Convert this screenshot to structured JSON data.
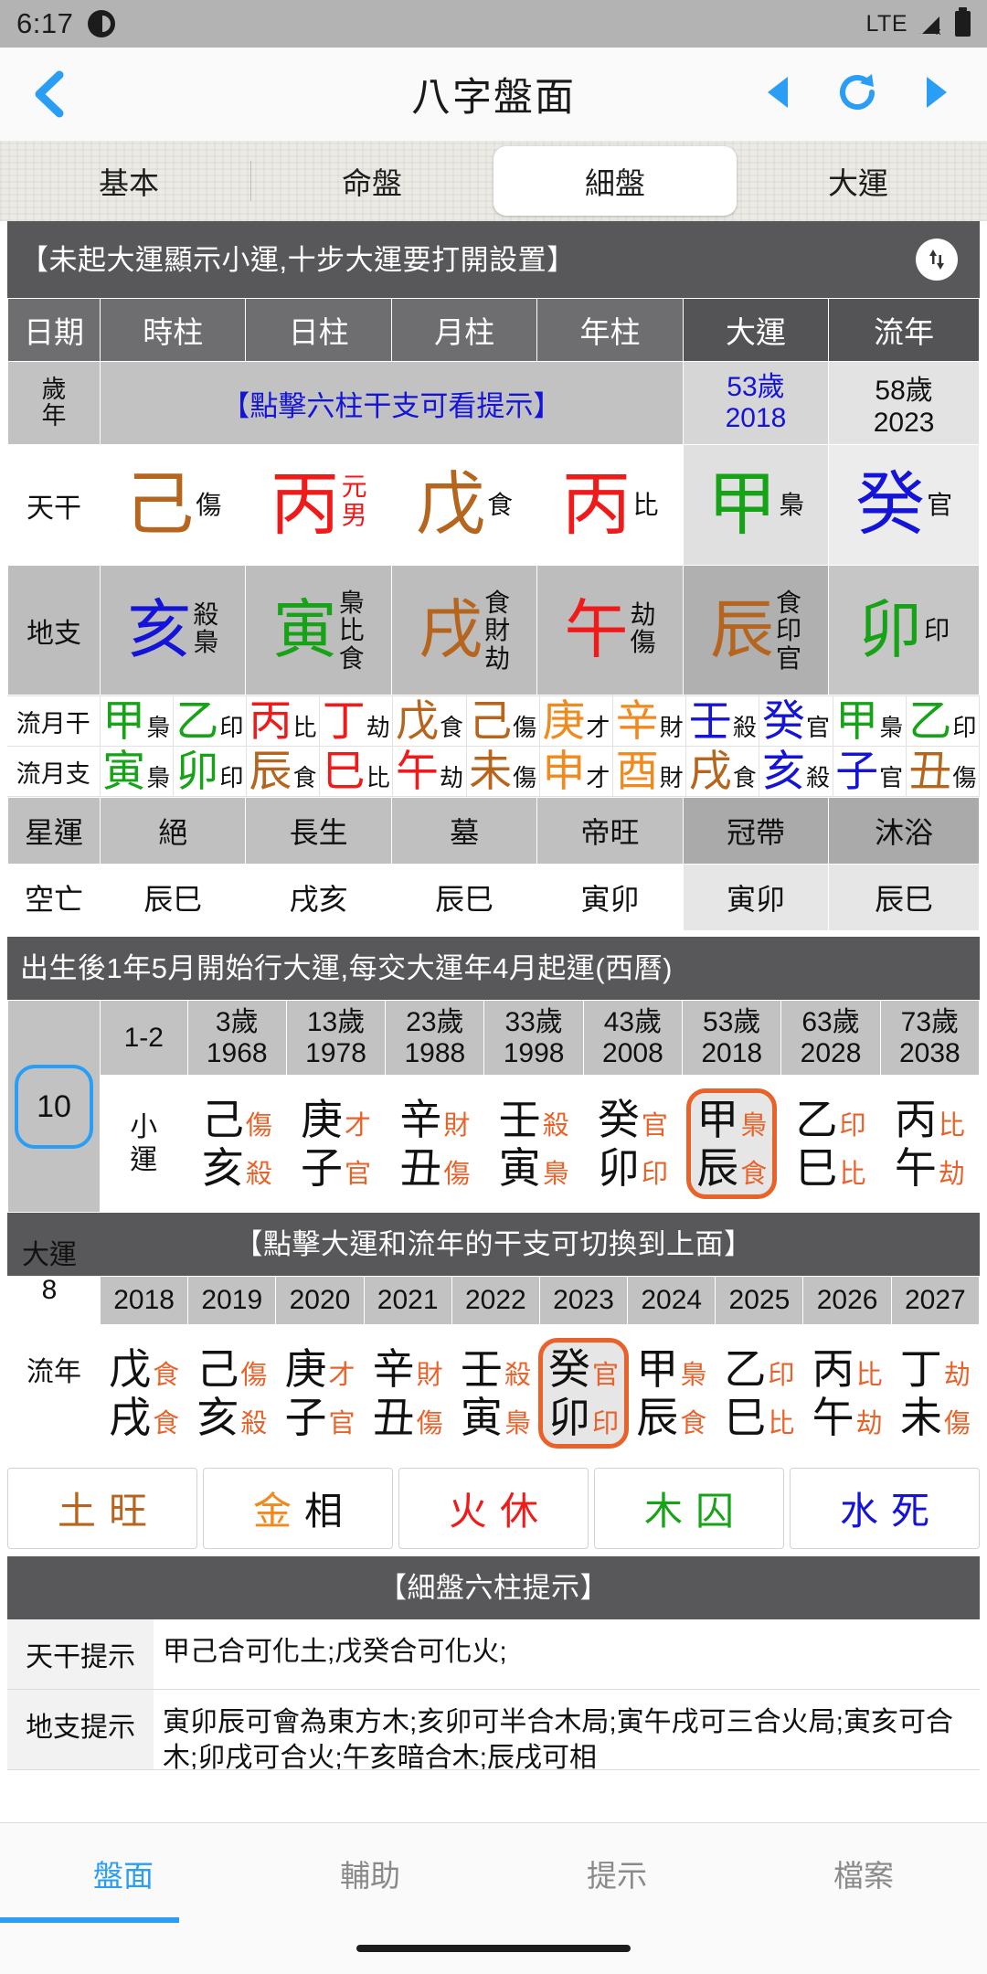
{
  "status_bar": {
    "time": "6:17",
    "network": "LTE",
    "app_icon": "app-circle-icon",
    "signal_icon": "signal-off-icon",
    "battery_icon": "battery-full-icon"
  },
  "title_bar": {
    "back_icon": "chevron-left-icon",
    "title": "八字盤面",
    "prev_icon": "triangle-left-icon",
    "refresh_icon": "refresh-icon",
    "next_icon": "triangle-right-icon",
    "accent": "#2a9df4"
  },
  "tabs": [
    {
      "label": "基本",
      "selected": false
    },
    {
      "label": "命盤",
      "selected": false
    },
    {
      "label": "細盤",
      "selected": true
    },
    {
      "label": "大運",
      "selected": false
    }
  ],
  "banner_top": {
    "text": "【未起大運顯示小運,十步大運要打開設置】",
    "swap_icon": "swap-vertical-icon"
  },
  "grid": {
    "headers": [
      "日期",
      "時柱",
      "日柱",
      "月柱",
      "年柱",
      "大運",
      "流年"
    ],
    "age_row": {
      "label_line1": "歲",
      "label_line2": "年",
      "note": "【點擊六柱干支可看提示】",
      "dayun_age": "53歲",
      "dayun_year": "2018",
      "liunian_age": "58歲",
      "liunian_year": "2023"
    },
    "stems": {
      "label": "天干",
      "cells": [
        {
          "char": "己",
          "color": "#b5651d",
          "ann": [
            "傷"
          ]
        },
        {
          "char": "丙",
          "color": "#ef1b1b",
          "ann": [
            "元",
            "男"
          ],
          "ann_color": "#ef1b1b"
        },
        {
          "char": "戊",
          "color": "#b5651d",
          "ann": [
            "食"
          ]
        },
        {
          "char": "丙",
          "color": "#ef1b1b",
          "ann": [
            "比"
          ]
        },
        {
          "char": "甲",
          "color": "#17a317",
          "ann": [
            "梟"
          ]
        },
        {
          "char": "癸",
          "color": "#1414d8",
          "ann": [
            "官"
          ]
        }
      ]
    },
    "branches": {
      "label": "地支",
      "cells": [
        {
          "char": "亥",
          "color": "#1414d8",
          "ann": [
            "殺",
            "梟"
          ]
        },
        {
          "char": "寅",
          "color": "#17a317",
          "ann": [
            "梟",
            "比",
            "食"
          ]
        },
        {
          "char": "戌",
          "color": "#b5651d",
          "ann": [
            "食",
            "財",
            "劫"
          ]
        },
        {
          "char": "午",
          "color": "#ef1b1b",
          "ann": [
            "劫",
            "傷"
          ]
        },
        {
          "char": "辰",
          "color": "#b5651d",
          "ann": [
            "食",
            "印",
            "官"
          ]
        },
        {
          "char": "卯",
          "color": "#17a317",
          "ann": [
            "印"
          ]
        }
      ]
    },
    "month_stems": {
      "label": "流月干",
      "cells": [
        {
          "char": "甲",
          "color": "#17a317",
          "ann": "梟"
        },
        {
          "char": "乙",
          "color": "#17a317",
          "ann": "印"
        },
        {
          "char": "丙",
          "color": "#ef1b1b",
          "ann": "比"
        },
        {
          "char": "丁",
          "color": "#ef1b1b",
          "ann": "劫"
        },
        {
          "char": "戊",
          "color": "#b5651d",
          "ann": "食"
        },
        {
          "char": "己",
          "color": "#b5651d",
          "ann": "傷"
        },
        {
          "char": "庚",
          "color": "#f08a1e",
          "ann": "才"
        },
        {
          "char": "辛",
          "color": "#f08a1e",
          "ann": "財"
        },
        {
          "char": "壬",
          "color": "#1414d8",
          "ann": "殺"
        },
        {
          "char": "癸",
          "color": "#1414d8",
          "ann": "官"
        },
        {
          "char": "甲",
          "color": "#17a317",
          "ann": "梟"
        },
        {
          "char": "乙",
          "color": "#17a317",
          "ann": "印"
        }
      ]
    },
    "month_branches": {
      "label": "流月支",
      "cells": [
        {
          "char": "寅",
          "color": "#17a317",
          "ann": "梟"
        },
        {
          "char": "卯",
          "color": "#17a317",
          "ann": "印"
        },
        {
          "char": "辰",
          "color": "#b5651d",
          "ann": "食"
        },
        {
          "char": "巳",
          "color": "#ef1b1b",
          "ann": "比"
        },
        {
          "char": "午",
          "color": "#ef1b1b",
          "ann": "劫"
        },
        {
          "char": "未",
          "color": "#b5651d",
          "ann": "傷"
        },
        {
          "char": "申",
          "color": "#f08a1e",
          "ann": "才"
        },
        {
          "char": "酉",
          "color": "#f08a1e",
          "ann": "財"
        },
        {
          "char": "戌",
          "color": "#b5651d",
          "ann": "食"
        },
        {
          "char": "亥",
          "color": "#1414d8",
          "ann": "殺"
        },
        {
          "char": "子",
          "color": "#1414d8",
          "ann": "官"
        },
        {
          "char": "丑",
          "color": "#b5651d",
          "ann": "傷"
        }
      ]
    },
    "star_luck": {
      "label": "星運",
      "values": [
        "絕",
        "長生",
        "墓",
        "帝旺",
        "冠帶",
        "沐浴"
      ]
    },
    "void": {
      "label": "空亡",
      "values": [
        "辰巳",
        "戌亥",
        "辰巳",
        "寅卯",
        "寅卯",
        "辰巳"
      ]
    }
  },
  "luck_section": {
    "banner": "出生後1年5月開始行大運,每交大運年4月起運(西曆)",
    "step_badge": "10",
    "row_label_line1": "大運",
    "row_label_line2": "8",
    "small_luck_label_line1": "小",
    "small_luck_label_line2": "運",
    "small_luck_age": "1-2",
    "columns": [
      {
        "age": "3歲",
        "year": "1968",
        "stem": "己",
        "stem_ann": "傷",
        "branch": "亥",
        "branch_ann": "殺",
        "selected": false
      },
      {
        "age": "13歲",
        "year": "1978",
        "stem": "庚",
        "stem_ann": "才",
        "branch": "子",
        "branch_ann": "官",
        "selected": false
      },
      {
        "age": "23歲",
        "year": "1988",
        "stem": "辛",
        "stem_ann": "財",
        "branch": "丑",
        "branch_ann": "傷",
        "selected": false
      },
      {
        "age": "33歲",
        "year": "1998",
        "stem": "壬",
        "stem_ann": "殺",
        "branch": "寅",
        "branch_ann": "梟",
        "selected": false
      },
      {
        "age": "43歲",
        "year": "2008",
        "stem": "癸",
        "stem_ann": "官",
        "branch": "卯",
        "branch_ann": "印",
        "selected": false
      },
      {
        "age": "53歲",
        "year": "2018",
        "stem": "甲",
        "stem_ann": "梟",
        "branch": "辰",
        "branch_ann": "食",
        "selected": true
      },
      {
        "age": "63歲",
        "year": "2028",
        "stem": "乙",
        "stem_ann": "印",
        "branch": "巳",
        "branch_ann": "比",
        "selected": false
      },
      {
        "age": "73歲",
        "year": "2038",
        "stem": "丙",
        "stem_ann": "比",
        "branch": "午",
        "branch_ann": "劫",
        "selected": false
      }
    ]
  },
  "banner_mid": "【點擊大運和流年的干支可切換到上面】",
  "fleeting_years": {
    "label": "流年",
    "columns": [
      {
        "year": "2018",
        "stem": "戊",
        "stem_ann": "食",
        "branch": "戌",
        "branch_ann": "食",
        "selected": false
      },
      {
        "year": "2019",
        "stem": "己",
        "stem_ann": "傷",
        "branch": "亥",
        "branch_ann": "殺",
        "selected": false
      },
      {
        "year": "2020",
        "stem": "庚",
        "stem_ann": "才",
        "branch": "子",
        "branch_ann": "官",
        "selected": false
      },
      {
        "year": "2021",
        "stem": "辛",
        "stem_ann": "財",
        "branch": "丑",
        "branch_ann": "傷",
        "selected": false
      },
      {
        "year": "2022",
        "stem": "壬",
        "stem_ann": "殺",
        "branch": "寅",
        "branch_ann": "梟",
        "selected": false
      },
      {
        "year": "2023",
        "stem": "癸",
        "stem_ann": "官",
        "branch": "卯",
        "branch_ann": "印",
        "selected": true
      },
      {
        "year": "2024",
        "stem": "甲",
        "stem_ann": "梟",
        "branch": "辰",
        "branch_ann": "食",
        "selected": false
      },
      {
        "year": "2025",
        "stem": "乙",
        "stem_ann": "印",
        "branch": "巳",
        "branch_ann": "比",
        "selected": false
      },
      {
        "year": "2026",
        "stem": "丙",
        "stem_ann": "比",
        "branch": "午",
        "branch_ann": "劫",
        "selected": false
      },
      {
        "year": "2027",
        "stem": "丁",
        "stem_ann": "劫",
        "branch": "未",
        "branch_ann": "傷",
        "selected": false
      }
    ]
  },
  "five_elements": [
    {
      "element": "土",
      "state": "旺",
      "color": "#b5651d"
    },
    {
      "element": "金",
      "state": "相",
      "color": "#f08a1e"
    },
    {
      "element": "火",
      "state": "休",
      "color": "#ef1b1b"
    },
    {
      "element": "木",
      "state": "囚",
      "color": "#17a317"
    },
    {
      "element": "水",
      "state": "死",
      "color": "#1414d8"
    }
  ],
  "hints": {
    "banner": "【細盤六柱提示】",
    "rows": [
      {
        "label": "天干提示",
        "value": "甲己合可化土;戊癸合可化火;"
      },
      {
        "label": "地支提示",
        "value": "寅卯辰可會為東方木;亥卯可半合木局;寅午戌可三合火局;寅亥可合木;卯戌可合火;午亥暗合木;辰戌可相"
      }
    ]
  },
  "bottom_nav": [
    {
      "label": "盤面",
      "active": true
    },
    {
      "label": "輔助",
      "active": false
    },
    {
      "label": "提示",
      "active": false
    },
    {
      "label": "檔案",
      "active": false
    }
  ]
}
